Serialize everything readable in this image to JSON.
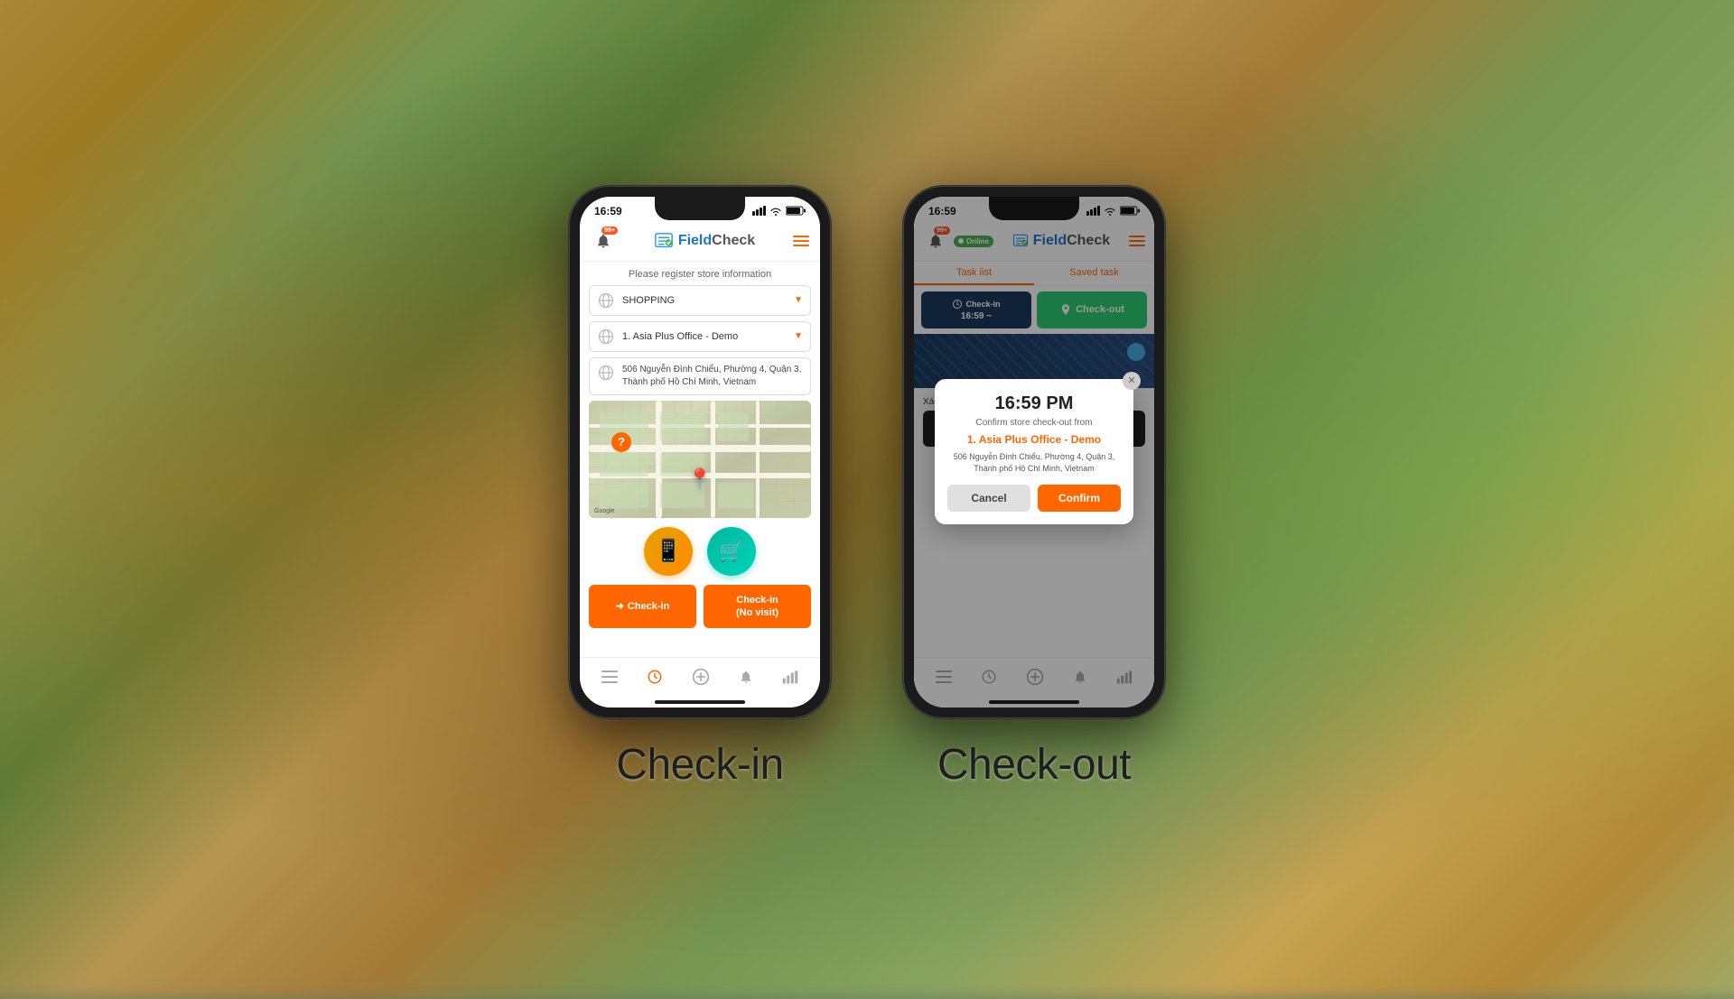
{
  "background": {
    "color": "#7a8a6a"
  },
  "checkin_phone": {
    "label": "Check-in",
    "status_bar": {
      "time": "16:59",
      "signal": "●●●",
      "wifi": "WiFi",
      "battery": "🔋"
    },
    "header": {
      "bell_badge": "99+",
      "app_name": "FieldCheck",
      "app_name_prefix": "Field",
      "app_name_suffix": "Check"
    },
    "content": {
      "register_text": "Please register store information",
      "dropdown1_value": "SHOPPING",
      "dropdown2_value": "1. Asia Plus Office - Demo",
      "address": "506 Nguyễn Đình Chiểu, Phường 4, Quận 3, Thành phố Hồ Chí Minh, Vietnam",
      "btn_checkin": "Check-in",
      "btn_checkin_no_visit_line1": "Check-in",
      "btn_checkin_no_visit_line2": "(No visit)"
    },
    "bottom_nav": {
      "items": [
        "≡",
        "⏰",
        "⊕",
        "🔔",
        "📊"
      ]
    }
  },
  "checkout_phone": {
    "label": "Check-out",
    "status_bar": {
      "time": "16:59"
    },
    "header": {
      "bell_badge": "99+",
      "online_label": "Online",
      "app_name_prefix": "Field",
      "app_name_suffix": "Check"
    },
    "tabs": {
      "task_list": "Task list",
      "saved_task": "Saved task"
    },
    "checkin_bar": {
      "checkin_label": "Check-in",
      "checkin_time": "16:59 ~",
      "checkout_label": "Check-out"
    },
    "modal": {
      "time": "16:59 PM",
      "confirm_text": "Confirm store check-out from",
      "store_name": "1. Asia Plus Office - Demo",
      "address": "506 Nguyễn Đình Chiểu, Phường 4, Quận 3, Thành phố Hồ Chí Minh, Vietnam",
      "cancel_label": "Cancel",
      "confirm_label": "Confirm"
    },
    "below_modal": {
      "verify_text": "Xác nhận quầy trưng bày"
    },
    "bottom_nav": {
      "items": [
        "≡",
        "⏰",
        "⊕",
        "🔔",
        "📊"
      ]
    }
  }
}
